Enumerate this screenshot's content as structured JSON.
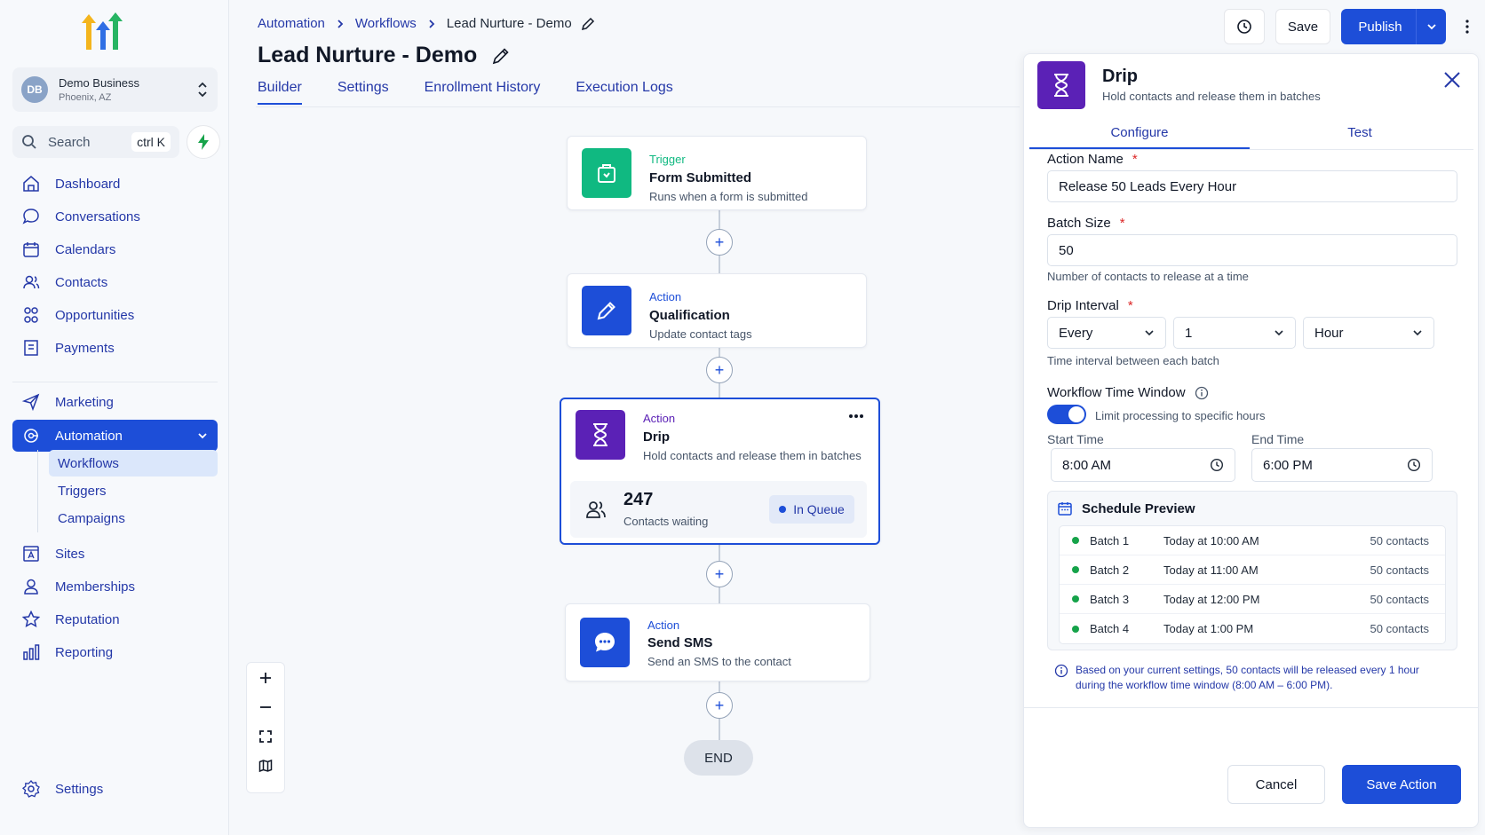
{
  "business": {
    "initials": "DB",
    "name": "Demo Business",
    "location": "Phoenix, AZ"
  },
  "search": {
    "placeholder": "Search",
    "shortcut": "ctrl K"
  },
  "sidebar": {
    "items": [
      {
        "label": "Dashboard",
        "icon": "home-icon"
      },
      {
        "label": "Conversations",
        "icon": "chat-icon"
      },
      {
        "label": "Calendars",
        "icon": "calendar-icon"
      },
      {
        "label": "Contacts",
        "icon": "users-icon"
      },
      {
        "label": "Opportunities",
        "icon": "flower-icon"
      },
      {
        "label": "Payments",
        "icon": "receipt-icon"
      }
    ],
    "items2": [
      {
        "label": "Marketing",
        "icon": "send-icon"
      },
      {
        "label": "Automation",
        "icon": "automation-icon"
      }
    ],
    "automation_sub": [
      "Workflows",
      "Triggers",
      "Campaigns"
    ],
    "items3": [
      {
        "label": "Sites",
        "icon": "sites-icon"
      },
      {
        "label": "Memberships",
        "icon": "person-icon"
      },
      {
        "label": "Reputation",
        "icon": "star-icon"
      },
      {
        "label": "Reporting",
        "icon": "bar-chart-icon"
      }
    ],
    "settings": "Settings"
  },
  "breadcrumb": {
    "root": "Automation",
    "mid": "Workflows",
    "current": "Lead Nurture - Demo"
  },
  "page": {
    "title": "Lead Nurture - Demo"
  },
  "tabs": [
    "Builder",
    "Settings",
    "Enrollment History",
    "Execution Logs"
  ],
  "toolbar": {
    "save": "Save",
    "publish": "Publish"
  },
  "nodes": {
    "trigger": {
      "kind": "Trigger",
      "name": "Form Submitted",
      "desc": "Runs when a form is submitted"
    },
    "qualification": {
      "kind": "Action",
      "name": "Qualification",
      "desc": "Update contact tags"
    },
    "drip": {
      "kind": "Action",
      "name": "Drip",
      "desc": "Hold contacts and release them in batches",
      "waiting_count": "247",
      "waiting_label": "Contacts waiting",
      "status": "In Queue"
    },
    "sms": {
      "kind": "Action",
      "name": "Send SMS",
      "desc": "Send an SMS to the contact"
    },
    "end": "END"
  },
  "panel": {
    "title": "Drip",
    "subtitle": "Hold contacts and release them in batches",
    "tabs": [
      "Configure",
      "Test"
    ],
    "action_name_label": "Action Name",
    "action_name_value": "Release 50 Leads Every Hour",
    "batch_size_label": "Batch Size",
    "batch_size_value": "50",
    "batch_size_help": "Number of contacts to release at a time",
    "drip_interval_label": "Drip Interval",
    "interval_every": "Every",
    "interval_count": "1",
    "interval_unit": "Hour",
    "interval_help": "Time interval between each batch",
    "window_label": "Workflow Time Window",
    "window_toggle_label": "Limit processing to specific hours",
    "window_enabled": true,
    "start_label": "Start Time",
    "start_value": "8:00 AM",
    "end_label": "End Time",
    "end_value": "6:00 PM",
    "schedule_title": "Schedule Preview",
    "schedule": [
      {
        "batch": "Batch 1",
        "when": "Today at 10:00 AM",
        "count": "50 contacts"
      },
      {
        "batch": "Batch 2",
        "when": "Today at 11:00 AM",
        "count": "50 contacts"
      },
      {
        "batch": "Batch 3",
        "when": "Today at 12:00 PM",
        "count": "50 contacts"
      },
      {
        "batch": "Batch 4",
        "when": "Today at 1:00 PM",
        "count": "50 contacts"
      }
    ],
    "note": "Based on your current settings, 50 contacts will be released every 1 hour during the workflow time window (8:00 AM – 6:00 PM).",
    "cancel": "Cancel",
    "save_action": "Save Action"
  },
  "colors": {
    "accent": "#1d4ed8",
    "trigger": "#10b981",
    "drip": "#5b21b6",
    "required": "#dc2626",
    "status_dot": "#16a34a"
  }
}
